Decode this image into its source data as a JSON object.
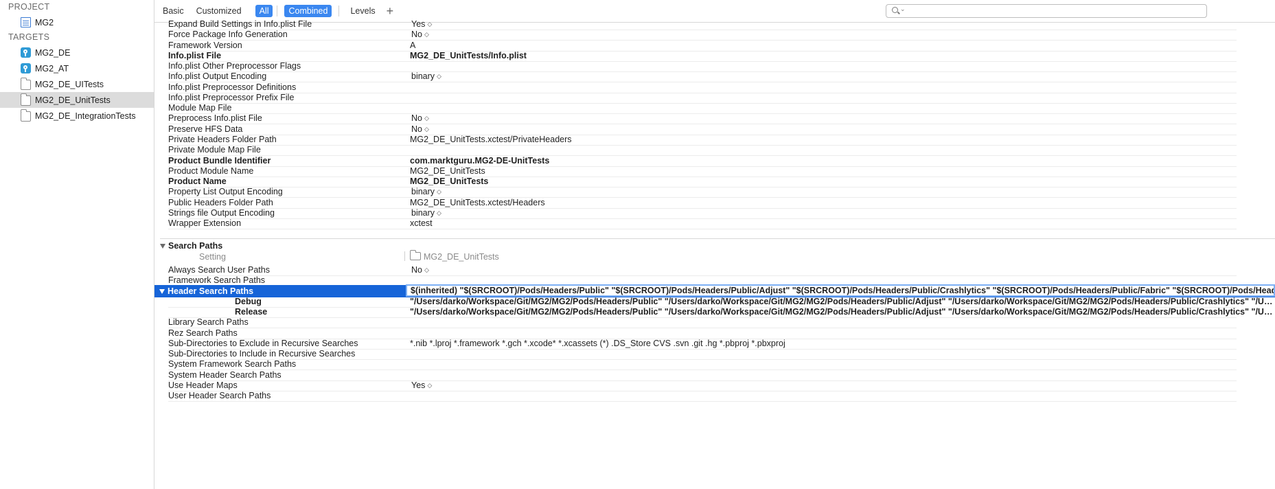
{
  "sidebar": {
    "project_header": "PROJECT",
    "project_name": "MG2",
    "targets_header": "TARGETS",
    "targets": [
      {
        "label": "MG2_DE",
        "icon": "app-icon"
      },
      {
        "label": "MG2_AT",
        "icon": "app-icon"
      },
      {
        "label": "MG2_DE_UITests",
        "icon": "folder-icon"
      },
      {
        "label": "MG2_DE_UnitTests",
        "icon": "folder-icon",
        "selected": true
      },
      {
        "label": "MG2_DE_IntegrationTests",
        "icon": "folder-icon"
      }
    ]
  },
  "toolbar": {
    "tabs": [
      "Basic",
      "Customized",
      "All",
      "Combined",
      "Levels"
    ],
    "selected_tabs": [
      "All",
      "Combined"
    ],
    "add_label": "+",
    "search_placeholder": ""
  },
  "packaging_rows": [
    {
      "name": "Expand Build Settings in Info.plist File",
      "value": "Yes",
      "popup": true
    },
    {
      "name": "Force Package Info Generation",
      "value": "No",
      "popup": true
    },
    {
      "name": "Framework Version",
      "value": "A"
    },
    {
      "name": "Info.plist File",
      "value": "MG2_DE_UnitTests/Info.plist",
      "bold": true
    },
    {
      "name": "Info.plist Other Preprocessor Flags",
      "value": ""
    },
    {
      "name": "Info.plist Output Encoding",
      "value": "binary",
      "popup": true
    },
    {
      "name": "Info.plist Preprocessor Definitions",
      "value": ""
    },
    {
      "name": "Info.plist Preprocessor Prefix File",
      "value": ""
    },
    {
      "name": "Module Map File",
      "value": ""
    },
    {
      "name": "Preprocess Info.plist File",
      "value": "No",
      "popup": true
    },
    {
      "name": "Preserve HFS Data",
      "value": "No",
      "popup": true
    },
    {
      "name": "Private Headers Folder Path",
      "value": "MG2_DE_UnitTests.xctest/PrivateHeaders"
    },
    {
      "name": "Private Module Map File",
      "value": ""
    },
    {
      "name": "Product Bundle Identifier",
      "value": "com.marktguru.MG2-DE-UnitTests",
      "bold": true
    },
    {
      "name": "Product Module Name",
      "value": "MG2_DE_UnitTests"
    },
    {
      "name": "Product Name",
      "value": "MG2_DE_UnitTests",
      "bold": true
    },
    {
      "name": "Property List Output Encoding",
      "value": "binary",
      "popup": true
    },
    {
      "name": "Public Headers Folder Path",
      "value": "MG2_DE_UnitTests.xctest/Headers"
    },
    {
      "name": "Strings file Output Encoding",
      "value": "binary",
      "popup": true
    },
    {
      "name": "Wrapper Extension",
      "value": "xctest"
    }
  ],
  "search_paths": {
    "title": "Search Paths",
    "col_setting": "Setting",
    "col_target": "MG2_DE_UnitTests",
    "rows_before": [
      {
        "name": "Always Search User Paths",
        "value": "No",
        "popup": true
      },
      {
        "name": "Framework Search Paths",
        "value": ""
      }
    ],
    "header_search": {
      "name": "Header Search Paths",
      "value": "$(inherited) \"$(SRCROOT)/Pods/Headers/Public\" \"$(SRCROOT)/Pods/Headers/Public/Adjust\" \"$(SRCROOT)/Pods/Headers/Public/Crashlytics\" \"$(SRCROOT)/Pods/Headers/Public/Fabric\" \"$(SRCROOT)/Pods/Headers/Public/G",
      "debug_label": "Debug",
      "debug_value": "\"/Users/darko/Workspace/Git/MG2/MG2/Pods/Headers/Public\" \"/Users/darko/Workspace/Git/MG2/MG2/Pods/Headers/Public/Adjust\" \"/Users/darko/Workspace/Git/MG2/MG2/Pods/Headers/Public/Crashlytics\" \"/Users/darko/Workspace/Git/MG2/MG2/Pods/Headers/Public/Fabric\"",
      "release_label": "Release",
      "release_value": "\"/Users/darko/Workspace/Git/MG2/MG2/Pods/Headers/Public\" \"/Users/darko/Workspace/Git/MG2/MG2/Pods/Headers/Public/Adjust\" \"/Users/darko/Workspace/Git/MG2/MG2/Pods/Headers/Public/Crashlytics\" \"/Users/darko/Workspace/Git/MG2/MG2/Pods/Headers/Public/Fabric\""
    },
    "rows_after": [
      {
        "name": "Library Search Paths",
        "value": ""
      },
      {
        "name": "Rez Search Paths",
        "value": ""
      },
      {
        "name": "Sub-Directories to Exclude in Recursive Searches",
        "value": "*.nib *.lproj *.framework *.gch *.xcode* *.xcassets (*) .DS_Store CVS .svn .git .hg *.pbproj *.pbxproj"
      },
      {
        "name": "Sub-Directories to Include in Recursive Searches",
        "value": ""
      },
      {
        "name": "System Framework Search Paths",
        "value": ""
      },
      {
        "name": "System Header Search Paths",
        "value": ""
      },
      {
        "name": "Use Header Maps",
        "value": "Yes",
        "popup": true
      },
      {
        "name": "User Header Search Paths",
        "value": ""
      }
    ]
  },
  "colors": {
    "accent": "#3a87f0",
    "selection": "#1664d8"
  }
}
